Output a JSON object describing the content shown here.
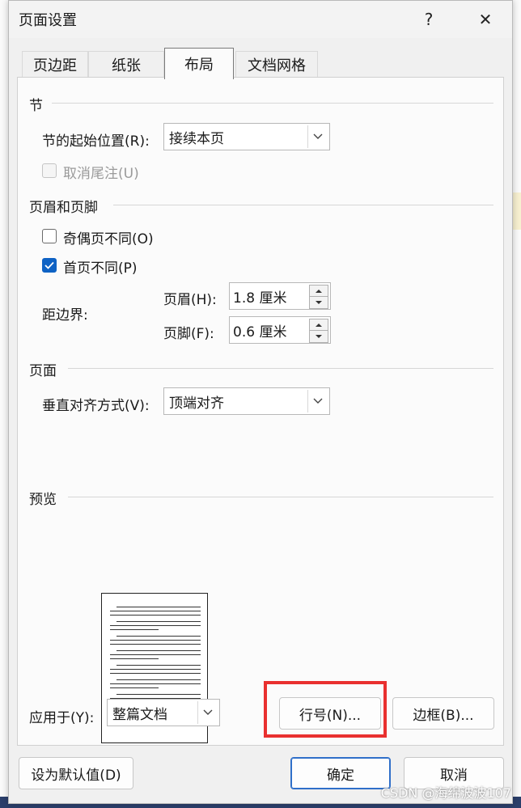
{
  "dialog": {
    "title": "页面设置",
    "help_icon": "?",
    "close_icon": "✕"
  },
  "tabs": [
    {
      "label": "页边距",
      "active": false
    },
    {
      "label": "纸张",
      "active": false
    },
    {
      "label": "布局",
      "active": true
    },
    {
      "label": "文档网格",
      "active": false
    }
  ],
  "section_section": {
    "heading": "节",
    "start_label": "节的起始位置(R):",
    "start_value": "接续本页",
    "suppress_endnotes_label": "取消尾注(U)",
    "suppress_endnotes_checked": false,
    "suppress_endnotes_disabled": true
  },
  "header_footer": {
    "heading": "页眉和页脚",
    "odd_even_label": "奇偶页不同(O)",
    "odd_even_checked": false,
    "first_page_label": "首页不同(P)",
    "first_page_checked": true,
    "from_edge_label": "距边界:",
    "header_label": "页眉(H):",
    "header_value": "1.8 厘米",
    "footer_label": "页脚(F):",
    "footer_value": "0.6 厘米"
  },
  "page": {
    "heading": "页面",
    "vertical_align_label": "垂直对齐方式(V):",
    "vertical_align_value": "顶端对齐"
  },
  "preview": {
    "heading": "预览"
  },
  "apply": {
    "label": "应用于(Y):",
    "value": "整篇文档"
  },
  "buttons": {
    "line_numbers": "行号(N)...",
    "borders": "边框(B)...",
    "set_default": "设为默认值(D)",
    "ok": "确定",
    "cancel": "取消"
  },
  "watermark": "CSDN @海绵波波107",
  "colors": {
    "accent": "#0e62c4",
    "highlight": "#e9302f"
  }
}
